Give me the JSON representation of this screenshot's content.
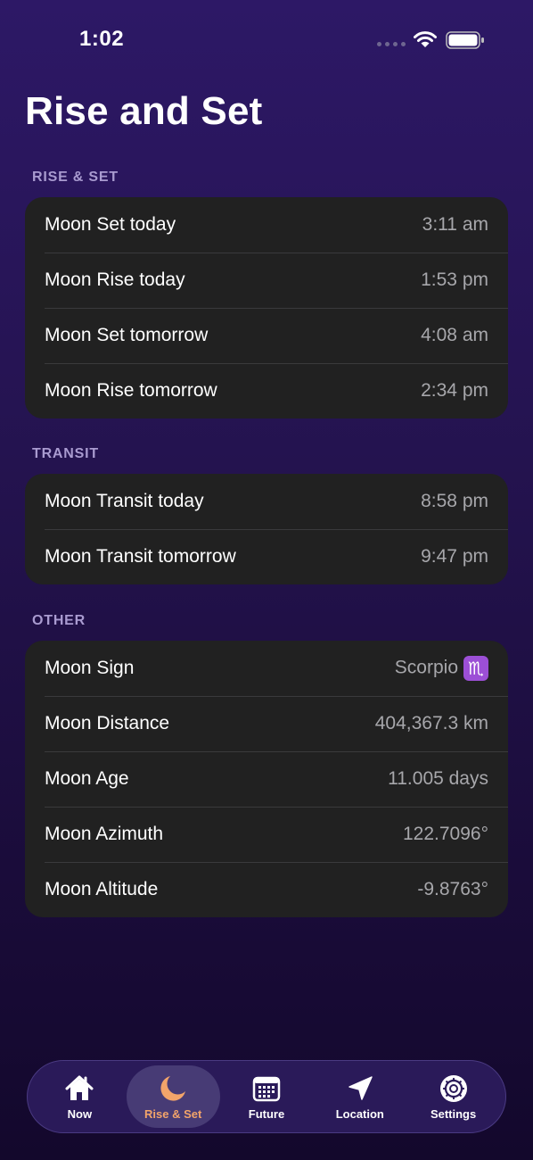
{
  "status_bar": {
    "time": "1:02"
  },
  "title": "Rise and Set",
  "sections": {
    "rise_set": {
      "header": "RISE & SET",
      "rows": [
        {
          "label": "Moon Set today",
          "value": "3:11 am"
        },
        {
          "label": "Moon Rise today",
          "value": "1:53 pm"
        },
        {
          "label": "Moon Set tomorrow",
          "value": "4:08 am"
        },
        {
          "label": "Moon Rise tomorrow",
          "value": "2:34 pm"
        }
      ]
    },
    "transit": {
      "header": "TRANSIT",
      "rows": [
        {
          "label": "Moon Transit today",
          "value": "8:58 pm"
        },
        {
          "label": "Moon Transit tomorrow",
          "value": "9:47 pm"
        }
      ]
    },
    "other": {
      "header": "OTHER",
      "rows": [
        {
          "label": "Moon Sign",
          "value": "Scorpio",
          "badge": "♏"
        },
        {
          "label": "Moon Distance",
          "value": "404,367.3 km"
        },
        {
          "label": "Moon Age",
          "value": "11.005 days"
        },
        {
          "label": "Moon Azimuth",
          "value": "122.7096°"
        },
        {
          "label": "Moon Altitude",
          "value": "-9.8763°"
        }
      ]
    }
  },
  "tabs": [
    {
      "label": "Now",
      "icon": "house-icon"
    },
    {
      "label": "Rise & Set",
      "icon": "moon-icon",
      "active": true
    },
    {
      "label": "Future",
      "icon": "calendar-icon"
    },
    {
      "label": "Location",
      "icon": "location-arrow-icon"
    },
    {
      "label": "Settings",
      "icon": "gear-icon"
    }
  ],
  "colors": {
    "accent": "#f2a46a",
    "card": "#212121",
    "section_header": "#a99bd0",
    "background_top": "#2d1866",
    "background_bottom": "#13082c"
  }
}
